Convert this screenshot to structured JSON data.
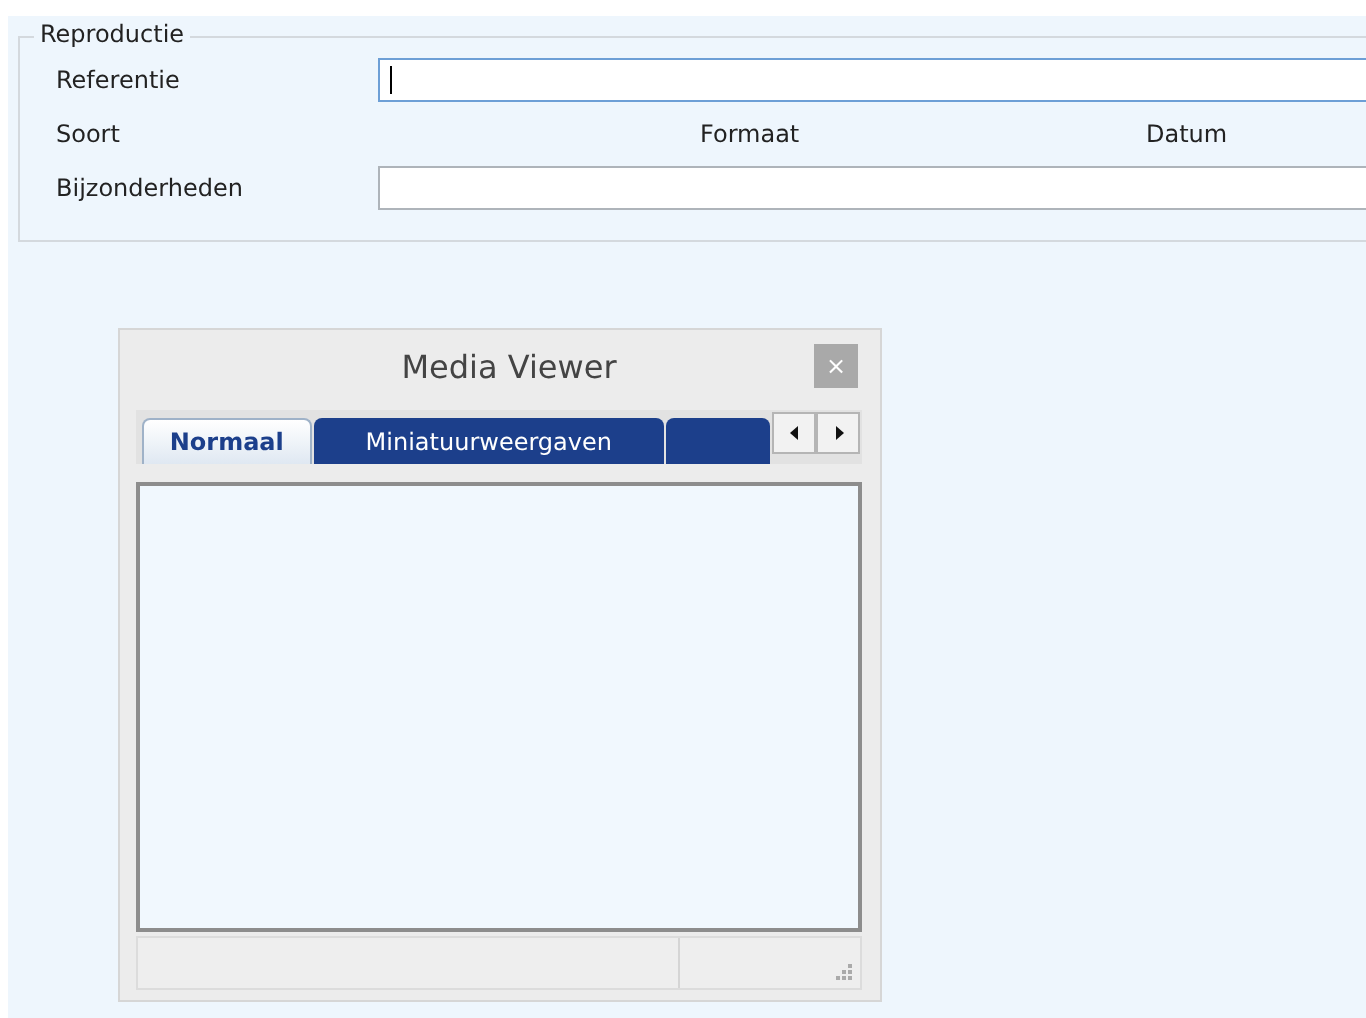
{
  "group": {
    "title": "Reproductie",
    "rows": [
      {
        "kind": "field",
        "label": "Referentie",
        "focused": true
      },
      {
        "kind": "columns",
        "labels": [
          "Soort",
          "Formaat",
          "Datum"
        ]
      },
      {
        "kind": "field",
        "label": "Bijzonderheden",
        "focused": false
      }
    ]
  },
  "media_viewer": {
    "title": "Media Viewer",
    "close": "×",
    "tabs": [
      {
        "label": "Normaal",
        "selected": true
      },
      {
        "label": "Miniatuurweergaven",
        "selected": false
      },
      {
        "selected": false
      }
    ]
  }
}
